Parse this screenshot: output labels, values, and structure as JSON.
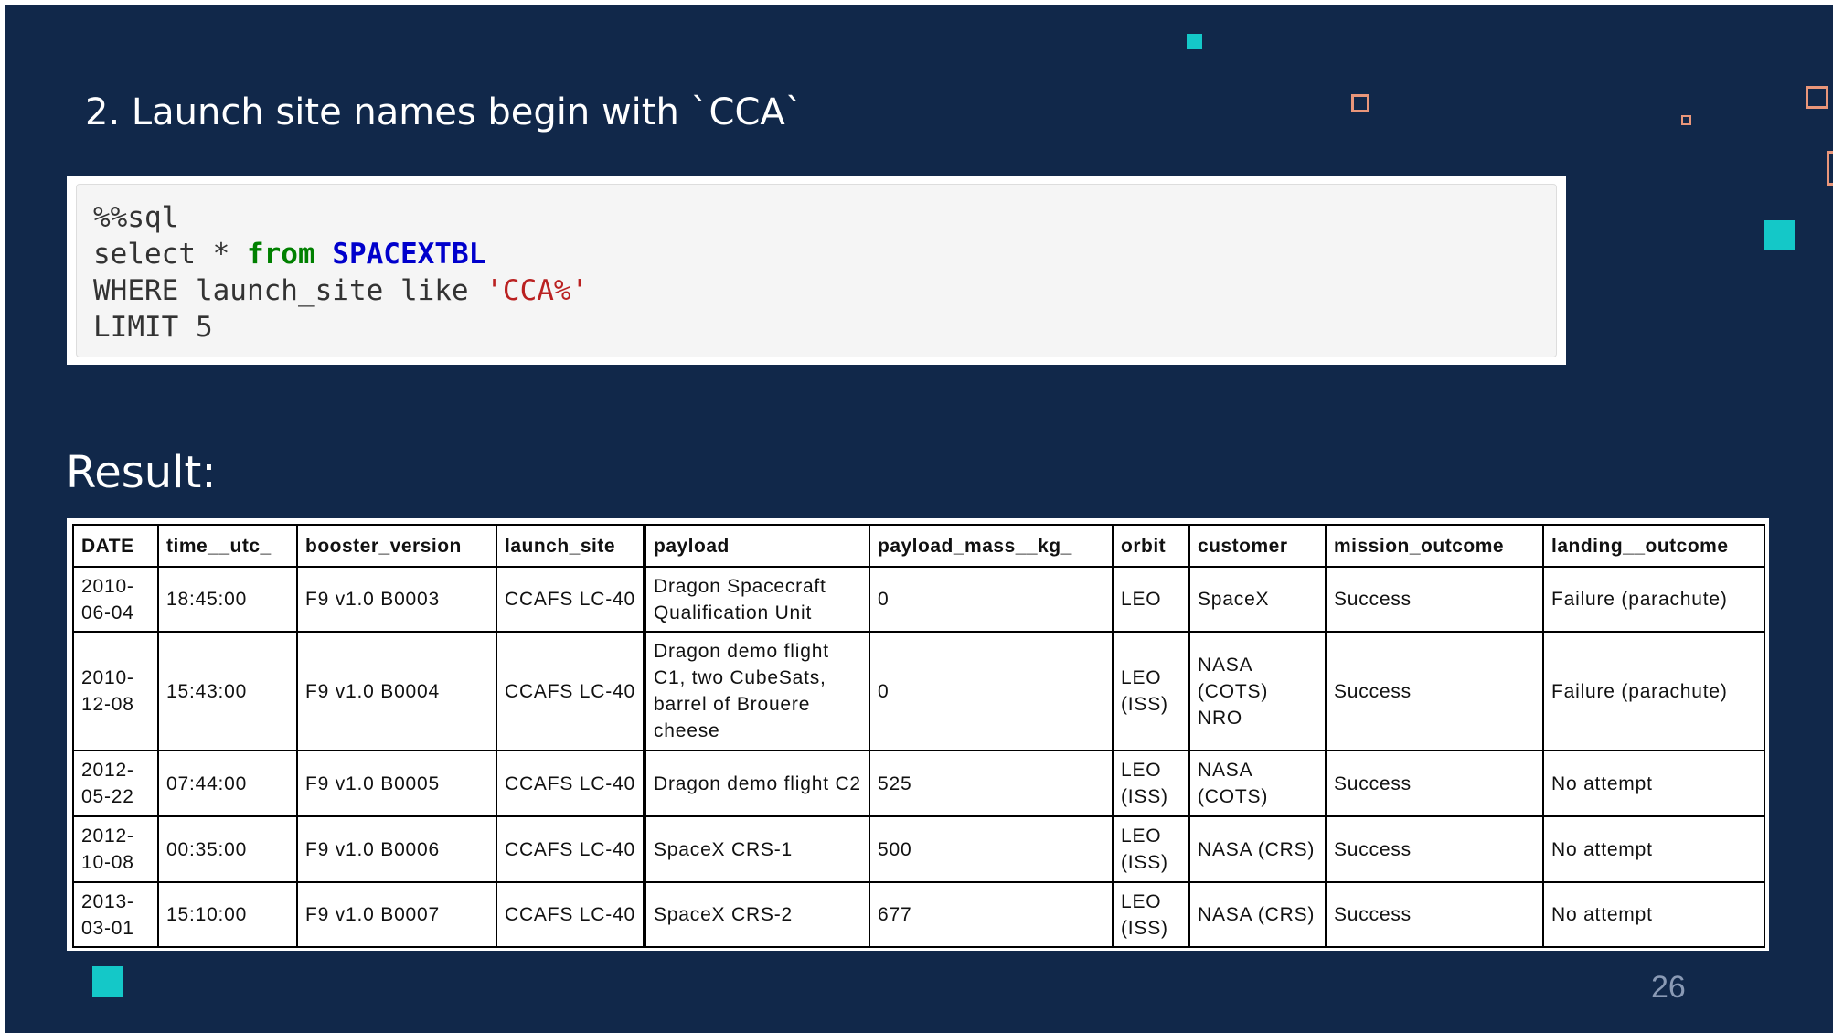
{
  "slide": {
    "title": "2. Launch site names begin with `CCA`",
    "result_label": "Result:",
    "page_number": "26"
  },
  "code": {
    "line1": "%%sql",
    "line2_select": "select * ",
    "line2_from": "from",
    "line2_table": "SPACEXTBL",
    "line3_where": "WHERE launch_site like ",
    "line3_pattern": "'CCA%'",
    "line4": "LIMIT 5"
  },
  "table": {
    "headers": [
      "DATE",
      "time__utc_",
      "booster_version",
      "launch_site",
      "payload",
      "payload_mass__kg_",
      "orbit",
      "customer",
      "mission_outcome",
      "landing__outcome"
    ],
    "rows": [
      [
        "2010-06-04",
        "18:45:00",
        "F9 v1.0 B0003",
        "CCAFS LC-40",
        "Dragon Spacecraft Qualification Unit",
        "0",
        "LEO",
        "SpaceX",
        "Success",
        "Failure (parachute)"
      ],
      [
        "2010-12-08",
        "15:43:00",
        "F9 v1.0 B0004",
        "CCAFS LC-40",
        "Dragon demo flight C1, two CubeSats, barrel of Brouere cheese",
        "0",
        "LEO (ISS)",
        "NASA (COTS) NRO",
        "Success",
        "Failure (parachute)"
      ],
      [
        "2012-05-22",
        "07:44:00",
        "F9 v1.0 B0005",
        "CCAFS LC-40",
        "Dragon demo flight C2",
        "525",
        "LEO (ISS)",
        "NASA (COTS)",
        "Success",
        "No attempt"
      ],
      [
        "2012-10-08",
        "00:35:00",
        "F9 v1.0 B0006",
        "CCAFS LC-40",
        "SpaceX CRS-1",
        "500",
        "LEO (ISS)",
        "NASA (CRS)",
        "Success",
        "No attempt"
      ],
      [
        "2013-03-01",
        "15:10:00",
        "F9 v1.0 B0007",
        "CCAFS LC-40",
        "SpaceX CRS-2",
        "677",
        "LEO (ISS)",
        "NASA (CRS)",
        "Success",
        "No attempt"
      ]
    ]
  },
  "colors": {
    "background": "#11284a",
    "accent_fill": "#14c8c8",
    "accent_outline": "#e9967a",
    "sql_keyword": "#008000",
    "sql_table": "#0000cc",
    "sql_string": "#ba2121"
  }
}
